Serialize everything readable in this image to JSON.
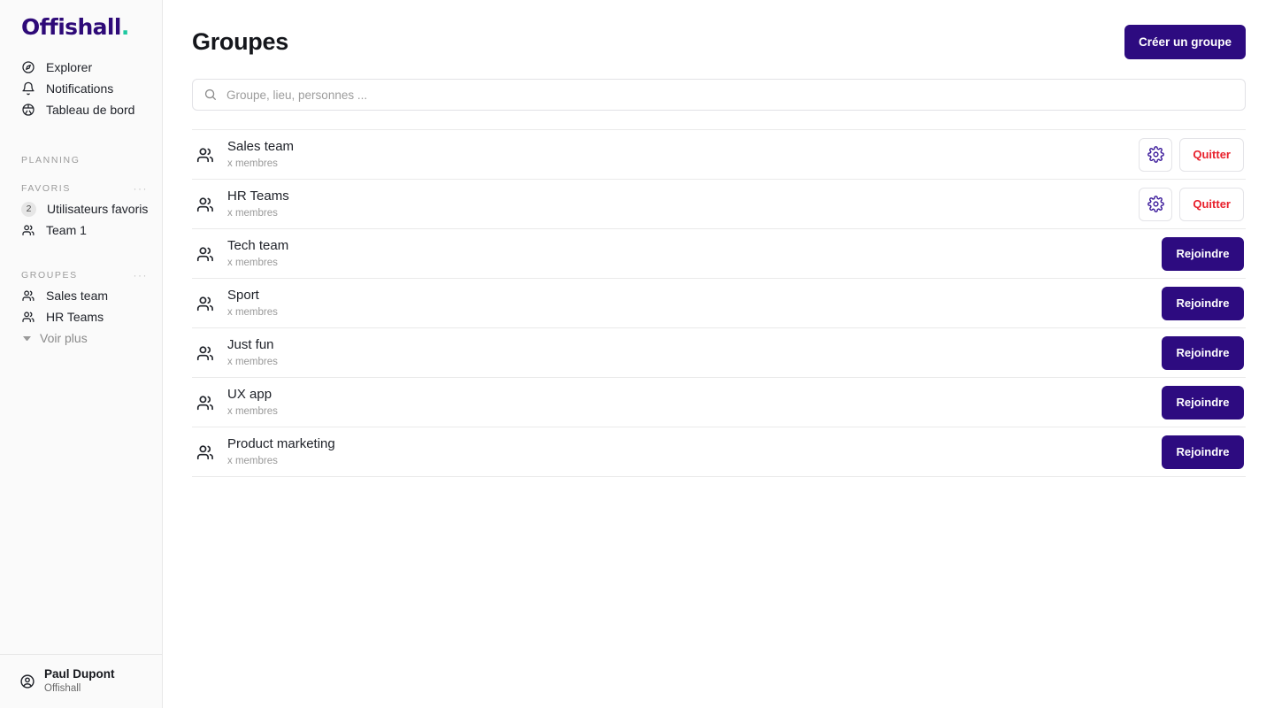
{
  "brand": {
    "logo_text": "Offishall",
    "logo_dot": ".",
    "primary_color": "#2d0b80",
    "accent_color": "#1ec8a0",
    "danger_color": "#e8212c"
  },
  "sidebar": {
    "nav": [
      {
        "label": "Explorer",
        "icon": "compass-icon"
      },
      {
        "label": "Notifications",
        "icon": "bell-icon"
      },
      {
        "label": "Tableau de bord",
        "icon": "dashboard-icon"
      }
    ],
    "planning_label": "PLANNING",
    "favoris": {
      "label": "FAVORIS",
      "menu": "···",
      "items": [
        {
          "label": "Utilisateurs favoris",
          "badge": "2",
          "icon": "badge-count"
        },
        {
          "label": "Team 1",
          "icon": "people-icon"
        }
      ]
    },
    "groupes": {
      "label": "GROUPES",
      "menu": "···",
      "items": [
        {
          "label": "Sales team",
          "icon": "people-icon"
        },
        {
          "label": "HR Teams",
          "icon": "people-icon"
        }
      ],
      "more_label": "Voir plus"
    },
    "user": {
      "name": "Paul Dupont",
      "org": "Offishall",
      "icon": "user-circle-icon"
    }
  },
  "main": {
    "title": "Groupes",
    "create_button": "Créer un groupe",
    "search": {
      "placeholder": "Groupe, lieu, personnes ...",
      "value": "",
      "icon": "search-icon"
    },
    "labels": {
      "join": "Rejoindre",
      "leave": "Quitter",
      "settings_icon": "gear-icon",
      "group_icon": "people-icon"
    },
    "groups": [
      {
        "name": "Sales team",
        "members": "x membres",
        "joined": true
      },
      {
        "name": "HR Teams",
        "members": "x membres",
        "joined": true
      },
      {
        "name": "Tech team",
        "members": "x membres",
        "joined": false
      },
      {
        "name": "Sport",
        "members": "x membres",
        "joined": false
      },
      {
        "name": "Just fun",
        "members": "x membres",
        "joined": false
      },
      {
        "name": "UX app",
        "members": "x membres",
        "joined": false
      },
      {
        "name": "Product marketing",
        "members": "x membres",
        "joined": false
      }
    ]
  }
}
